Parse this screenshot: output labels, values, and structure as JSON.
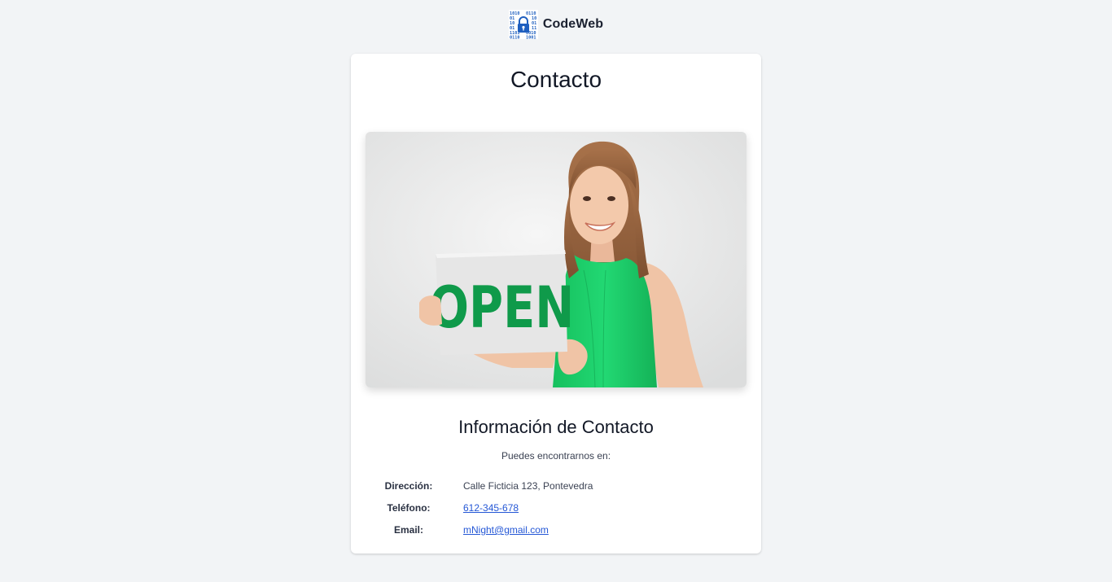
{
  "header": {
    "brand_name": "CodeWeb",
    "logo_icon": "binary-lock-icon",
    "logo_color": "#1f5fbf"
  },
  "main": {
    "title": "Contacto",
    "hero_image": {
      "icon": "woman-holding-open-sign-photo",
      "sign_text": "OPEN",
      "sign_color": "#0f9a4a"
    },
    "info": {
      "title": "Información de Contacto",
      "subtitle": "Puedes encontrarnos en:",
      "rows": [
        {
          "label": "Dirección:",
          "value": "Calle Ficticia 123, Pontevedra"
        },
        {
          "label": "Teléfono:",
          "value": "612-345-678"
        },
        {
          "label": "Email:",
          "value": "mNight@gmail.com"
        }
      ]
    }
  },
  "colors": {
    "background": "#f2f4f6",
    "card": "#ffffff",
    "link": "#2457d6",
    "shirt": "#1fd66e"
  }
}
